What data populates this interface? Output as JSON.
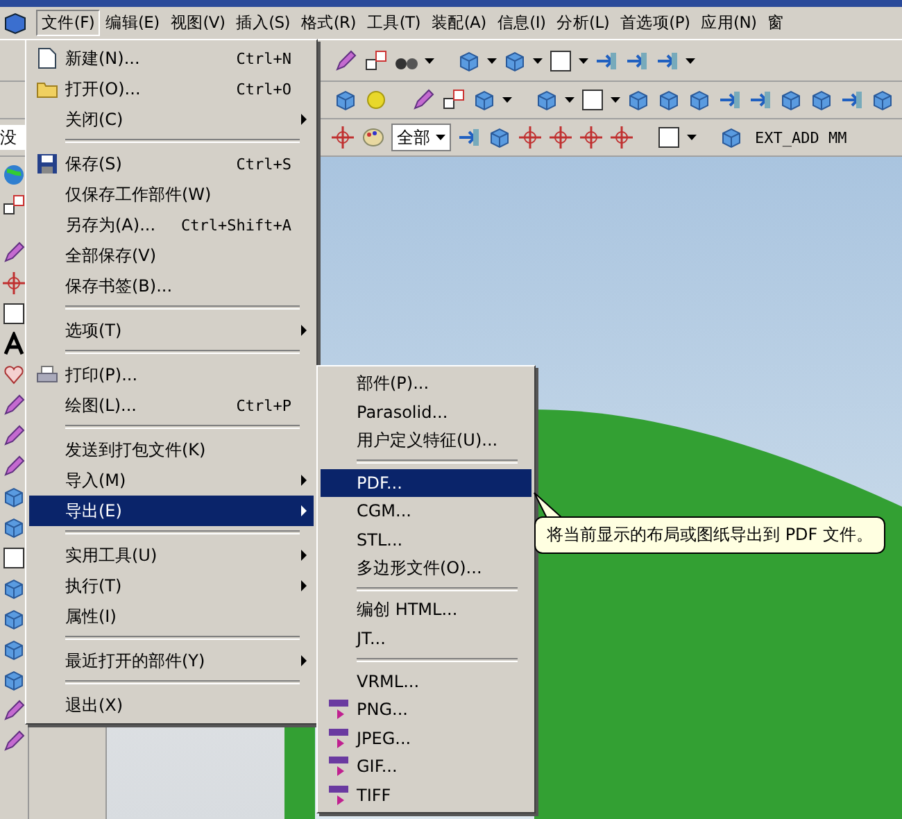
{
  "menu_bar": {
    "items": [
      {
        "label": "文件(F)",
        "selected": true
      },
      {
        "label": "编辑(E)",
        "selected": false
      },
      {
        "label": "视图(V)",
        "selected": false
      },
      {
        "label": "插入(S)",
        "selected": false
      },
      {
        "label": "格式(R)",
        "selected": false
      },
      {
        "label": "工具(T)",
        "selected": false
      },
      {
        "label": "装配(A)",
        "selected": false
      },
      {
        "label": "信息(I)",
        "selected": false
      },
      {
        "label": "分析(L)",
        "selected": false
      },
      {
        "label": "首选项(P)",
        "selected": false
      },
      {
        "label": "应用(N)",
        "selected": false
      },
      {
        "label": "窗",
        "selected": false
      }
    ]
  },
  "toolbar": {
    "layer_field": "没",
    "filter_dropdown": "全部",
    "status_text": "EXT_ADD MM"
  },
  "file_menu": {
    "items": [
      {
        "kind": "item",
        "label": "新建(N)...",
        "shortcut": "Ctrl+N",
        "submenu": false,
        "selected": false
      },
      {
        "kind": "item",
        "label": "打开(O)...",
        "shortcut": "Ctrl+O",
        "submenu": false,
        "selected": false
      },
      {
        "kind": "item",
        "label": "关闭(C)",
        "submenu": true,
        "selected": false
      },
      {
        "kind": "separator"
      },
      {
        "kind": "item",
        "label": "保存(S)",
        "shortcut": "Ctrl+S",
        "submenu": false,
        "selected": false
      },
      {
        "kind": "item",
        "label": "仅保存工作部件(W)",
        "submenu": false,
        "selected": false
      },
      {
        "kind": "item",
        "label": "另存为(A)...",
        "shortcut": "Ctrl+Shift+A",
        "submenu": false,
        "selected": false
      },
      {
        "kind": "item",
        "label": "全部保存(V)",
        "submenu": false,
        "selected": false
      },
      {
        "kind": "item",
        "label": "保存书签(B)...",
        "submenu": false,
        "selected": false
      },
      {
        "kind": "separator"
      },
      {
        "kind": "item",
        "label": "选项(T)",
        "submenu": true,
        "selected": false
      },
      {
        "kind": "separator"
      },
      {
        "kind": "item",
        "label": "打印(P)...",
        "submenu": false,
        "selected": false
      },
      {
        "kind": "item",
        "label": "绘图(L)...",
        "shortcut": "Ctrl+P",
        "submenu": false,
        "selected": false
      },
      {
        "kind": "separator"
      },
      {
        "kind": "item",
        "label": "发送到打包文件(K)",
        "submenu": false,
        "selected": false
      },
      {
        "kind": "item",
        "label": "导入(M)",
        "submenu": true,
        "selected": false
      },
      {
        "kind": "item",
        "label": "导出(E)",
        "submenu": true,
        "selected": true
      },
      {
        "kind": "separator"
      },
      {
        "kind": "item",
        "label": "实用工具(U)",
        "submenu": true,
        "selected": false
      },
      {
        "kind": "item",
        "label": "执行(T)",
        "submenu": true,
        "selected": false
      },
      {
        "kind": "item",
        "label": "属性(I)",
        "submenu": false,
        "selected": false
      },
      {
        "kind": "separator"
      },
      {
        "kind": "item",
        "label": "最近打开的部件(Y)",
        "submenu": true,
        "selected": false
      },
      {
        "kind": "separator"
      },
      {
        "kind": "item",
        "label": "退出(X)",
        "submenu": false,
        "selected": false
      }
    ]
  },
  "export_submenu": {
    "items": [
      {
        "kind": "item",
        "label": "部件(P)...",
        "selected": false
      },
      {
        "kind": "item",
        "label": "Parasolid...",
        "selected": false
      },
      {
        "kind": "item",
        "label": "用户定义特征(U)...",
        "selected": false
      },
      {
        "kind": "separator"
      },
      {
        "kind": "item",
        "label": "PDF...",
        "selected": true
      },
      {
        "kind": "item",
        "label": "CGM...",
        "selected": false
      },
      {
        "kind": "item",
        "label": "STL...",
        "selected": false
      },
      {
        "kind": "item",
        "label": "多边形文件(O)...",
        "selected": false
      },
      {
        "kind": "separator"
      },
      {
        "kind": "item",
        "label": "编创 HTML...",
        "selected": false
      },
      {
        "kind": "item",
        "label": "JT...",
        "selected": false
      },
      {
        "kind": "separator"
      },
      {
        "kind": "item",
        "label": "VRML...",
        "selected": false
      },
      {
        "kind": "item",
        "label": "PNG...",
        "selected": false
      },
      {
        "kind": "item",
        "label": "JPEG...",
        "selected": false
      },
      {
        "kind": "item",
        "label": "GIF...",
        "selected": false
      },
      {
        "kind": "item",
        "label": "TIFF",
        "selected": false
      }
    ]
  },
  "tooltip": "将当前显示的布局或图纸导出到 PDF 文件。"
}
